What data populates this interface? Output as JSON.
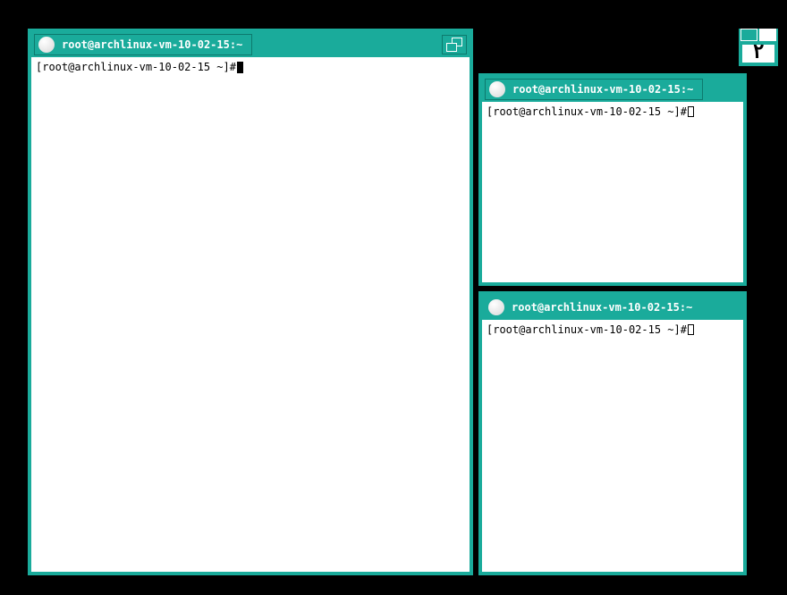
{
  "colors": {
    "accent": "#1aab9b",
    "bg_desktop": "#000000",
    "bg_terminal": "#ffffff",
    "fg_terminal": "#000000"
  },
  "windows": {
    "left": {
      "title": "root@archlinux-vm-10-02-15:~",
      "prompt": "[root@archlinux-vm-10-02-15 ~]#",
      "focused": true
    },
    "top_right": {
      "title": "root@archlinux-vm-10-02-15:~",
      "prompt": "[root@archlinux-vm-10-02-15 ~]#",
      "focused": false
    },
    "bottom_right": {
      "title": "root@archlinux-vm-10-02-15:~",
      "prompt": "[root@archlinux-vm-10-02-15 ~]#",
      "focused": false
    }
  },
  "widget": {
    "glyph": "٢"
  }
}
